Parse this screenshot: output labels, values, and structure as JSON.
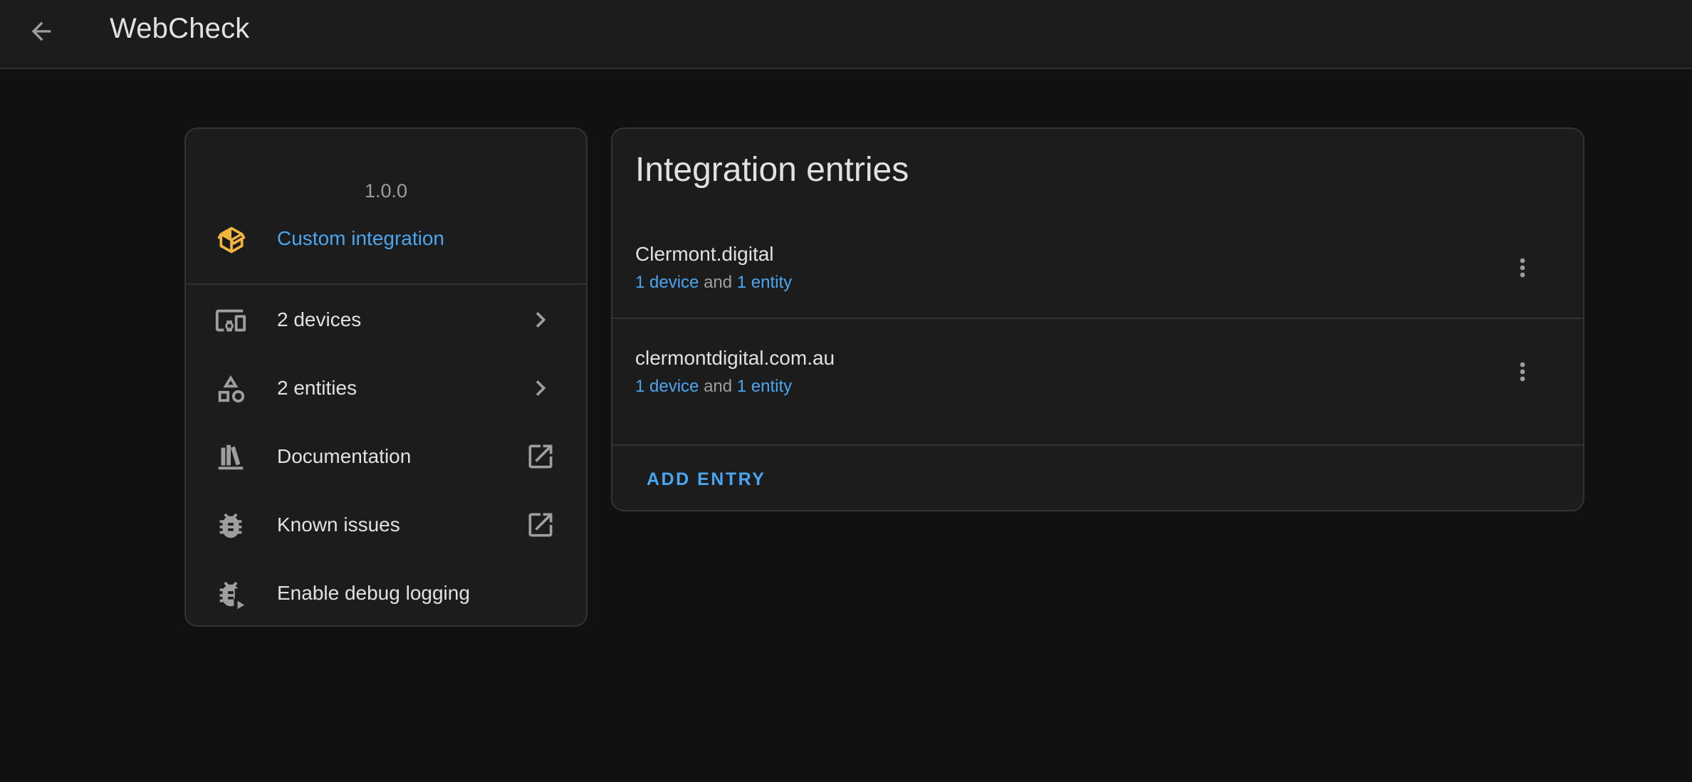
{
  "header": {
    "title": "WebCheck"
  },
  "info_card": {
    "version": "1.0.0",
    "custom_label": "Custom integration",
    "custom_color": "#f4b53f",
    "menu": [
      {
        "label": "2 devices",
        "icon": "devices-icon",
        "trail": "chevron-right-icon"
      },
      {
        "label": "2 entities",
        "icon": "shapes-icon",
        "trail": "chevron-right-icon"
      },
      {
        "label": "Documentation",
        "icon": "book-shelf-icon",
        "trail": "open-in-new-icon"
      },
      {
        "label": "Known issues",
        "icon": "bug-icon",
        "trail": "open-in-new-icon"
      },
      {
        "label": "Enable debug logging",
        "icon": "bug-play-icon",
        "trail": ""
      }
    ]
  },
  "entries_card": {
    "title": "Integration entries",
    "entries": [
      {
        "name": "Clermont.digital",
        "device_link": "1 device",
        "and_text": "and",
        "entity_link": "1 entity"
      },
      {
        "name": "clermontdigital.com.au",
        "device_link": "1 device",
        "and_text": "and",
        "entity_link": "1 entity"
      }
    ],
    "add_entry_label": "ADD ENTRY"
  },
  "colors": {
    "accent": "#4aa6f0",
    "background": "#111111",
    "card": "#1c1c1c"
  }
}
